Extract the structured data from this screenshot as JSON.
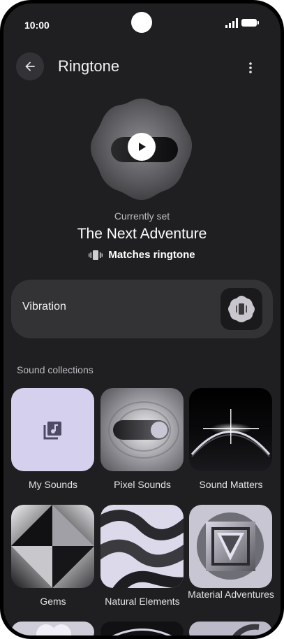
{
  "status": {
    "time": "10:00"
  },
  "header": {
    "title": "Ringtone"
  },
  "current": {
    "label": "Currently set",
    "name": "The Next Adventure",
    "vibration_match": "Matches ringtone"
  },
  "vibration": {
    "label": "Vibration"
  },
  "collections": {
    "title": "Sound collections",
    "items": [
      {
        "label": "My Sounds"
      },
      {
        "label": "Pixel Sounds"
      },
      {
        "label": "Sound Matters"
      },
      {
        "label": "Gems"
      },
      {
        "label": "Natural Elements"
      },
      {
        "label": "Material Adventures"
      }
    ]
  },
  "colors": {
    "background": "#1f1f21",
    "card": "#333336",
    "accent_tile": "#d6d0ef"
  },
  "icons": [
    "back-arrow-icon",
    "more-vert-icon",
    "play-icon",
    "vibration-icon",
    "music-library-icon"
  ]
}
